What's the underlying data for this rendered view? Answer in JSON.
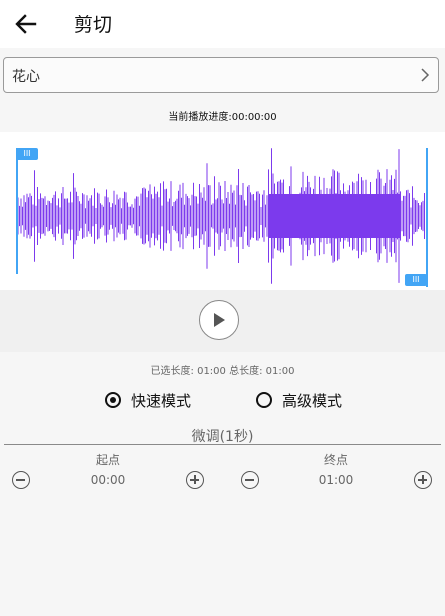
{
  "header": {
    "title": "剪切",
    "back_icon": "arrow-left-icon"
  },
  "song_select": {
    "value": "花心",
    "chevron_icon": "chevron-right-icon"
  },
  "progress": {
    "label": "当前播放进度:00:00:00"
  },
  "waveform": {
    "color": "#7c3aed",
    "handle_color": "#42a5f5",
    "start_handle_label": "III",
    "end_handle_label": "III"
  },
  "player": {
    "play_icon": "play-icon"
  },
  "length_info": {
    "text": "已选长度: 01:00  总长度: 01:00"
  },
  "modes": {
    "fast": {
      "label": "快速模式",
      "selected": true
    },
    "advanced": {
      "label": "高级模式",
      "selected": false
    }
  },
  "fine_tune": {
    "title": "微调(1秒)",
    "start": {
      "label": "起点",
      "value": "00:00"
    },
    "end": {
      "label": "终点",
      "value": "01:00"
    }
  }
}
